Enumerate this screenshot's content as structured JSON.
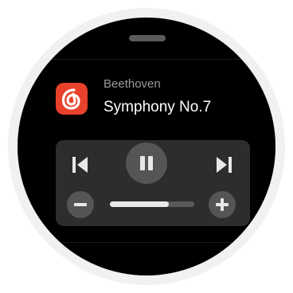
{
  "now_playing": {
    "artist": "Beethoven",
    "title": "Symphony No.7"
  },
  "app": {
    "icon": "netease-music-icon",
    "brand_color": "#e9412b"
  },
  "controls": {
    "previous": "previous-track-icon",
    "play_pause": "pause-icon",
    "next": "next-track-icon",
    "volume_down": "minus-icon",
    "volume_up": "plus-icon"
  },
  "volume": {
    "level_fraction": 0.7
  }
}
